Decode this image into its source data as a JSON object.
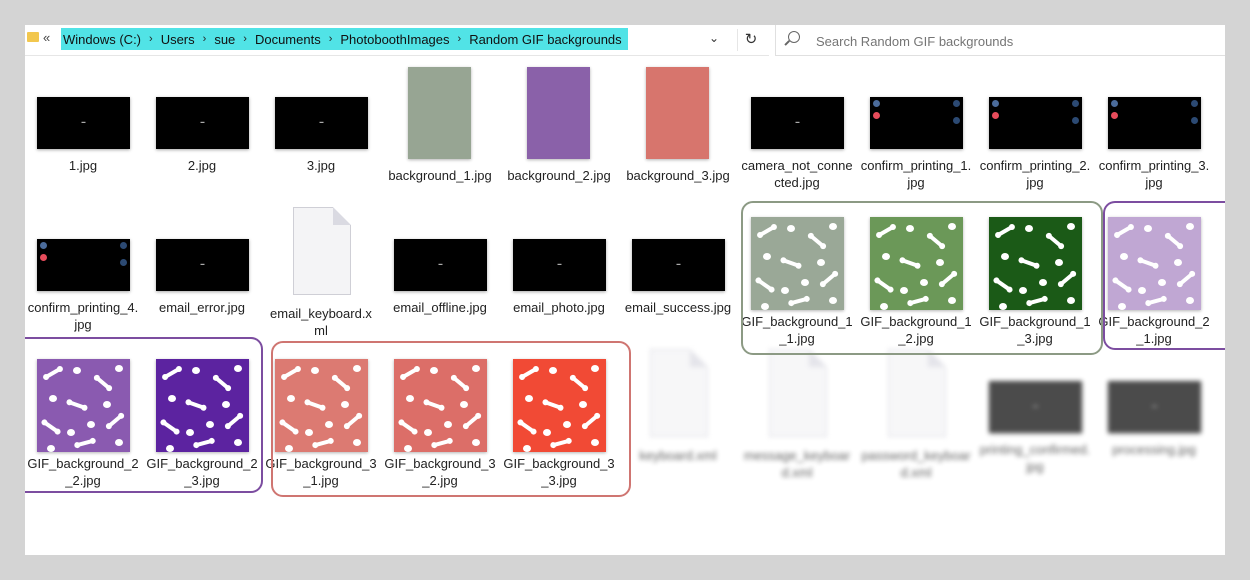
{
  "address_bar": {
    "back_glyph": "«",
    "crumbs": [
      "Windows (C:)",
      "Users",
      "sue",
      "Documents",
      "PhotoboothImages",
      "Random GIF backgrounds"
    ],
    "separator": "›",
    "dropdown_glyph": "⌄",
    "refresh_glyph": "↻"
  },
  "search": {
    "placeholder": "Search Random GIF backgrounds"
  },
  "colors": {
    "crumb_highlight": "#51e3e6",
    "sage_group": "#8c9a84",
    "purple_group": "#7c4da0",
    "coral_group": "#cf7571"
  },
  "files": [
    {
      "name": "1.jpg",
      "kind": "image-black"
    },
    {
      "name": "2.jpg",
      "kind": "image-black"
    },
    {
      "name": "3.jpg",
      "kind": "image-black"
    },
    {
      "name": "background_1.jpg",
      "kind": "image-solid",
      "color": "#97a593"
    },
    {
      "name": "background_2.jpg",
      "kind": "image-solid",
      "color": "#8a61a9"
    },
    {
      "name": "background_3.jpg",
      "kind": "image-solid",
      "color": "#d7756d"
    },
    {
      "name": "camera_not_connected.jpg",
      "kind": "image-black"
    },
    {
      "name": "confirm_printing_1.jpg",
      "kind": "image-black"
    },
    {
      "name": "confirm_printing_2.jpg",
      "kind": "image-black"
    },
    {
      "name": "confirm_printing_3.jpg",
      "kind": "image-black"
    },
    {
      "name": "confirm_printing_4.jpg",
      "kind": "image-black"
    },
    {
      "name": "email_error.jpg",
      "kind": "image-black"
    },
    {
      "name": "email_keyboard.xml",
      "kind": "document"
    },
    {
      "name": "email_offline.jpg",
      "kind": "image-black"
    },
    {
      "name": "email_photo.jpg",
      "kind": "image-black"
    },
    {
      "name": "email_success.jpg",
      "kind": "image-black"
    },
    {
      "name": "GIF_background_1_1.jpg",
      "kind": "pattern",
      "color": "#9aa897"
    },
    {
      "name": "GIF_background_1_2.jpg",
      "kind": "pattern",
      "color": "#6b9858"
    },
    {
      "name": "GIF_background_1_3.jpg",
      "kind": "pattern",
      "color": "#1b5a17"
    },
    {
      "name": "GIF_background_2_1.jpg",
      "kind": "pattern",
      "color": "#c0a7d3"
    },
    {
      "name": "GIF_background_2_2.jpg",
      "kind": "pattern",
      "color": "#8a5ab0"
    },
    {
      "name": "GIF_background_2_3.jpg",
      "kind": "pattern",
      "color": "#5c23a0"
    },
    {
      "name": "GIF_background_3_1.jpg",
      "kind": "pattern",
      "color": "#dc7a72"
    },
    {
      "name": "GIF_background_3_2.jpg",
      "kind": "pattern",
      "color": "#dc6e68"
    },
    {
      "name": "GIF_background_3_3.jpg",
      "kind": "pattern",
      "color": "#f14a35"
    },
    {
      "name": "keyboard.xml",
      "kind": "document"
    },
    {
      "name": "message_keyboard.xml",
      "kind": "document"
    },
    {
      "name": "password_keyboard.xml",
      "kind": "document"
    },
    {
      "name": "printing_confirmed.jpg",
      "kind": "image-black"
    },
    {
      "name": "processing.jpg",
      "kind": "image-black"
    }
  ]
}
